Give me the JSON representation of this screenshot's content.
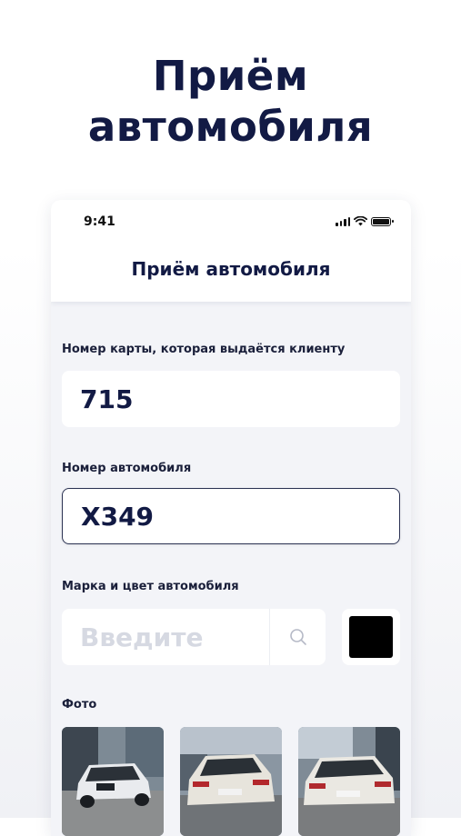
{
  "hero": {
    "line1": "Приём",
    "line2": "автомобиля"
  },
  "status_bar": {
    "time": "9:41"
  },
  "screen": {
    "title": "Приём автомобиля"
  },
  "form": {
    "card_number_label": "Номер карты, которая выдаётся клиенту",
    "card_number_value": "715",
    "plate_label": "Номер автомобиля",
    "plate_value": "Х349",
    "brand_color_label": "Марка и цвет автомобиля",
    "brand_placeholder": "Введите",
    "selected_color": "#000000",
    "photos_label": "Фото"
  },
  "colors": {
    "accent": "#121a44",
    "background": "#f3f4f8",
    "field_bg": "#ffffff"
  },
  "photos": [
    {
      "icon": "car-photo-front"
    },
    {
      "icon": "car-photo-rear"
    },
    {
      "icon": "car-photo-rear-side"
    }
  ]
}
